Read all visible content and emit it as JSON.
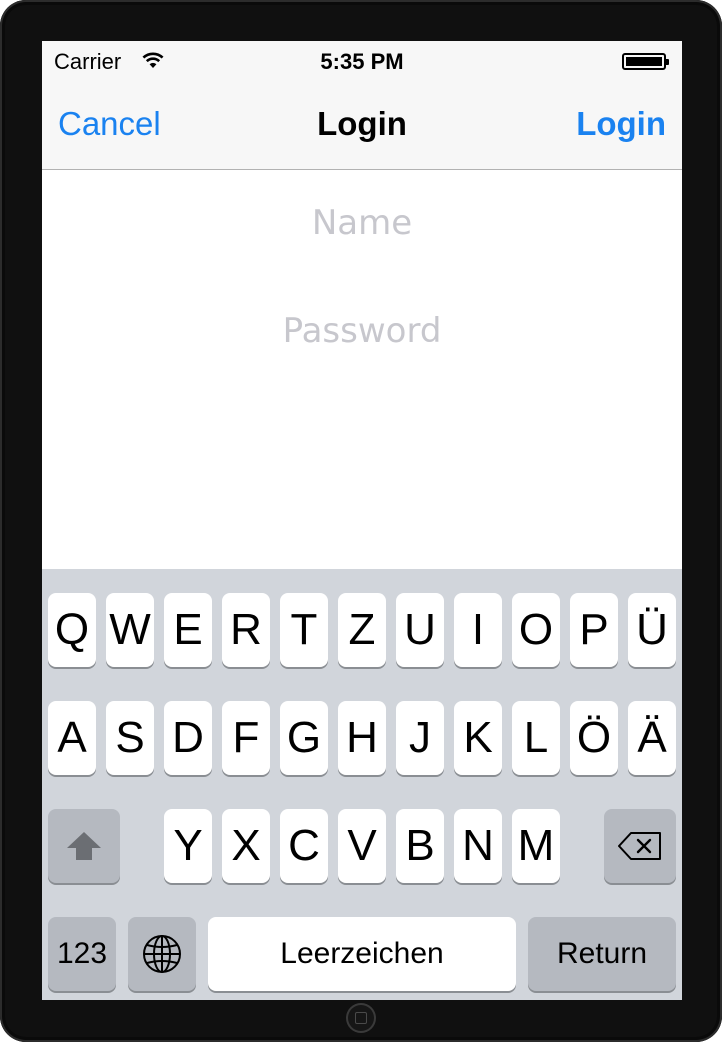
{
  "status_bar": {
    "carrier": "Carrier",
    "time": "5:35 PM"
  },
  "nav": {
    "cancel": "Cancel",
    "title": "Login",
    "login": "Login"
  },
  "form": {
    "name_placeholder": "Name",
    "password_placeholder": "Password"
  },
  "keyboard": {
    "row1": [
      "Q",
      "W",
      "E",
      "R",
      "T",
      "Z",
      "U",
      "I",
      "O",
      "P",
      "Ü"
    ],
    "row2": [
      "A",
      "S",
      "D",
      "F",
      "G",
      "H",
      "J",
      "K",
      "L",
      "Ö",
      "Ä"
    ],
    "row3": [
      "Y",
      "X",
      "C",
      "V",
      "B",
      "N",
      "M"
    ],
    "numbers": "123",
    "space": "Leerzeichen",
    "return": "Return",
    "icons": {
      "shift": "shift-icon",
      "delete": "backspace-icon",
      "globe": "globe-icon"
    }
  },
  "colors": {
    "tint": "#1a82f0",
    "keyboard_bg": "#d1d5db",
    "dark_key": "#b5b9c0"
  }
}
